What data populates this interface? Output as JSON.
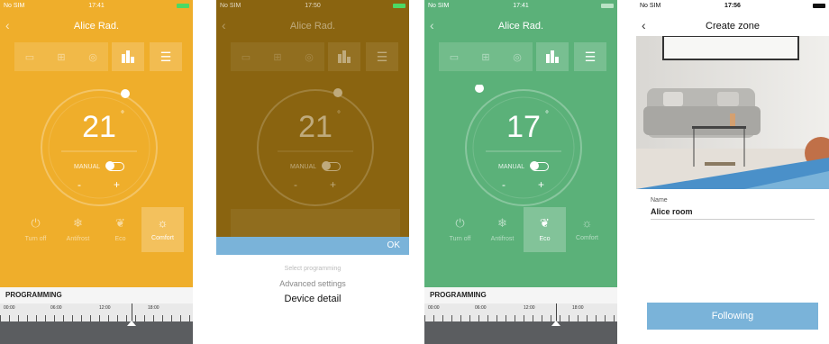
{
  "screens": [
    {
      "status": {
        "carrier": "No SIM",
        "time": "17:41"
      },
      "title": "Alice Rad.",
      "temperature": "21",
      "degree": "°",
      "manual_label": "MANUAL",
      "minus": "-",
      "plus": "+",
      "modes": [
        "Turn off",
        "Antifrost",
        "Eco",
        "Comfort"
      ],
      "active_mode": "Comfort",
      "programming_title": "PROGRAMMING",
      "timeline_labels": [
        "00:00",
        "06:00",
        "12:00",
        "18:00"
      ],
      "colors": {
        "background": "#efae2b"
      }
    },
    {
      "status": {
        "carrier": "No SIM",
        "time": "17:50"
      },
      "title": "Alice Rad.",
      "temperature": "21",
      "degree": "°",
      "manual_label": "MANUAL",
      "minus": "-",
      "plus": "+",
      "sheet": {
        "ok_label": "OK",
        "options": [
          "Select programming",
          "Advanced settings",
          "Device detail"
        ],
        "selected": "Device detail"
      },
      "colors": {
        "background": "#8a6410",
        "sheet_bar": "#7ab3d9"
      }
    },
    {
      "status": {
        "carrier": "No SIM",
        "time": "17:41"
      },
      "title": "Alice Rad.",
      "temperature": "17",
      "degree": "°",
      "manual_label": "MANUAL",
      "minus": "-",
      "plus": "+",
      "modes": [
        "Turn off",
        "Antifrost",
        "Eco",
        "Comfort"
      ],
      "active_mode": "Eco",
      "programming_title": "PROGRAMMING",
      "timeline_labels": [
        "00:00",
        "06:00",
        "12:00",
        "18:00"
      ],
      "colors": {
        "background": "#5bb179"
      }
    },
    {
      "status": {
        "carrier": "No SIM",
        "time": "17:56"
      },
      "title": "Create zone",
      "field_label": "Name",
      "field_value": "Alice room",
      "button_label": "Following",
      "colors": {
        "button": "#7ab3d9"
      }
    }
  ],
  "icons": {
    "back": "chevron-left-icon",
    "menu": "menu-icon",
    "stats": "bar-chart-icon",
    "calendar": "calendar-icon",
    "radiator": "radiator-icon",
    "power": "power-icon",
    "snowflake": "snowflake-icon",
    "leaf": "leaf-icon",
    "sun": "sun-icon"
  }
}
